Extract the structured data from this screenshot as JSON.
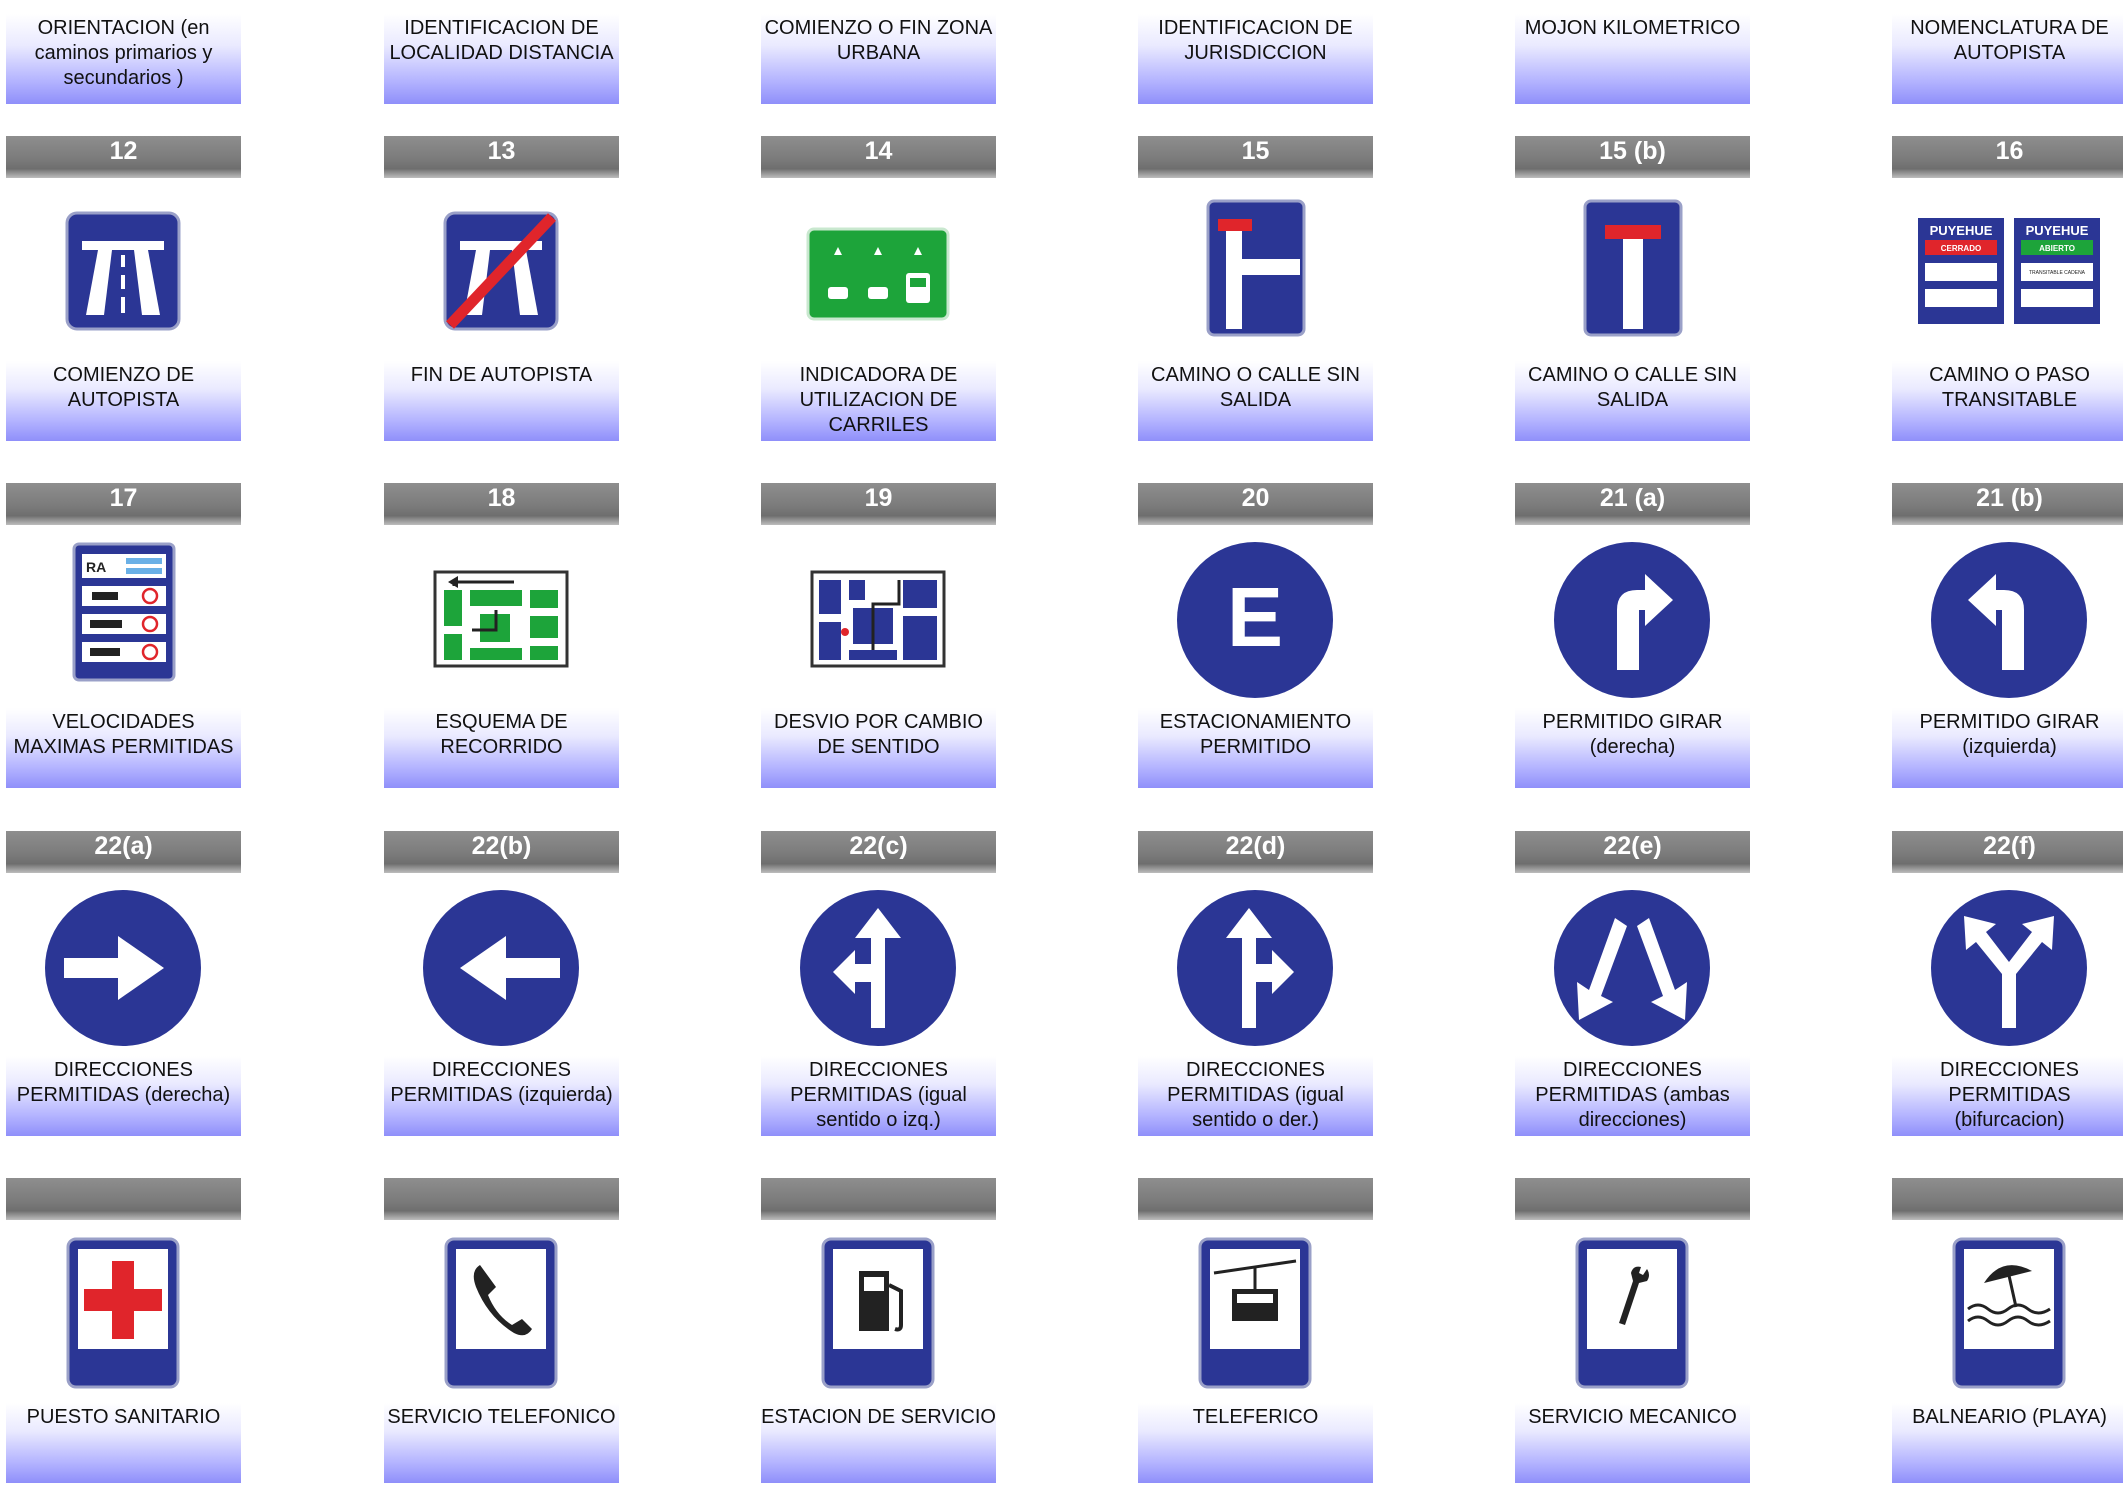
{
  "colors": {
    "sign_blue": "#2b3695",
    "sign_green": "#1da43a",
    "sign_red": "#e0252b",
    "header_gray": "#7b7b7b"
  },
  "top_row": [
    {
      "label": "ORIENTACION (en caminos primarios y secundarios )"
    },
    {
      "label": "IDENTIFICACION DE LOCALIDAD DISTANCIA"
    },
    {
      "label": "COMIENZO O FIN ZONA URBANA"
    },
    {
      "label": "IDENTIFICACION DE JURISDICCION"
    },
    {
      "label": "MOJON KILOMETRICO"
    },
    {
      "label": "NOMENCLATURA DE AUTOPISTA"
    }
  ],
  "rows": [
    [
      {
        "number": "12",
        "label": "COMIENZO DE AUTOPISTA",
        "icon": "highway-start-sign-icon"
      },
      {
        "number": "13",
        "label": "FIN DE AUTOPISTA",
        "icon": "highway-end-sign-icon"
      },
      {
        "number": "14",
        "label": "INDICADORA DE UTILIZACION DE CARRILES",
        "icon": "lane-usage-sign-icon"
      },
      {
        "number": "15",
        "label": "CAMINO O CALLE SIN SALIDA",
        "icon": "dead-end-side-sign-icon"
      },
      {
        "number": "15 (b)",
        "label": "CAMINO O CALLE SIN SALIDA",
        "icon": "dead-end-sign-icon"
      },
      {
        "number": "16",
        "label": "CAMINO O PASO TRANSITABLE",
        "icon": "pass-status-sign-icon"
      }
    ],
    [
      {
        "number": "17",
        "label": "VELOCIDADES MAXIMAS PERMITIDAS",
        "icon": "max-speeds-sign-icon"
      },
      {
        "number": "18",
        "label": "ESQUEMA DE RECORRIDO",
        "icon": "route-scheme-sign-icon"
      },
      {
        "number": "19",
        "label": "DESVIO POR CAMBIO DE SENTIDO",
        "icon": "detour-sign-icon"
      },
      {
        "number": "20",
        "label": "ESTACIONAMIENTO PERMITIDO",
        "icon": "parking-allowed-sign-icon"
      },
      {
        "number": "21 (a)",
        "label": "PERMITIDO GIRAR (derecha)",
        "icon": "turn-right-sign-icon"
      },
      {
        "number": "21 (b)",
        "label": "PERMITIDO GIRAR (izquierda)",
        "icon": "turn-left-sign-icon"
      }
    ],
    [
      {
        "number": "22(a)",
        "label": "DIRECCIONES PERMITIDAS (derecha)",
        "icon": "arrow-right-sign-icon"
      },
      {
        "number": "22(b)",
        "label": "DIRECCIONES PERMITIDAS (izquierda)",
        "icon": "arrow-left-sign-icon"
      },
      {
        "number": "22(c)",
        "label": "DIRECCIONES PERMITIDAS (igual sentido o izq.)",
        "icon": "straight-or-left-sign-icon"
      },
      {
        "number": "22(d)",
        "label": "DIRECCIONES PERMITIDAS (igual sentido o der.)",
        "icon": "straight-or-right-sign-icon"
      },
      {
        "number": "22(e)",
        "label": "DIRECCIONES PERMITIDAS (ambas direcciones)",
        "icon": "both-directions-sign-icon"
      },
      {
        "number": "22(f)",
        "label": "DIRECCIONES PERMITIDAS (bifurcacion)",
        "icon": "fork-sign-icon"
      }
    ],
    [
      {
        "number": "",
        "label": "PUESTO SANITARIO",
        "icon": "first-aid-sign-icon"
      },
      {
        "number": "",
        "label": "SERVICIO TELEFONICO",
        "icon": "telephone-sign-icon"
      },
      {
        "number": "",
        "label": "ESTACION DE SERVICIO",
        "icon": "fuel-station-sign-icon"
      },
      {
        "number": "",
        "label": "TELEFERICO",
        "icon": "cable-car-sign-icon"
      },
      {
        "number": "",
        "label": "SERVICIO MECANICO",
        "icon": "mechanic-sign-icon"
      },
      {
        "number": "",
        "label": "BALNEARIO (PLAYA)",
        "icon": "beach-sign-icon"
      }
    ]
  ],
  "sign_text": {
    "pass_name": "PUYEHUE",
    "pass_closed": "CERRADO",
    "pass_open": "ABIERTO",
    "pass_note": "TRANSITABLE CADENA",
    "speed_header": "RA",
    "parking_letter": "E"
  }
}
